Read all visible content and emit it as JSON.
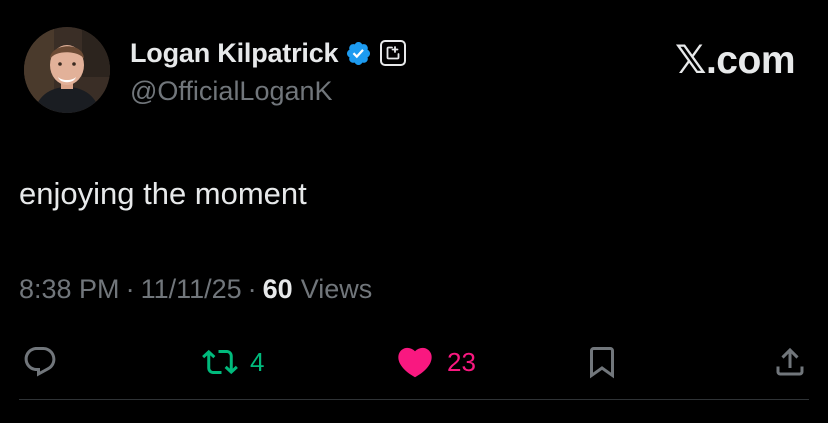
{
  "tweet": {
    "author": {
      "display_name": "Logan Kilpatrick",
      "handle": "@OfficialLoganK",
      "verified": true
    },
    "brand": "𝕏.com",
    "text": "enjoying the moment",
    "time": "8:38 PM",
    "separator": "·",
    "date": "11/11/25",
    "views_count": "60",
    "views_label": "Views"
  },
  "actions": {
    "reply_icon": "reply-icon",
    "retweet_count": "4",
    "like_count": "23",
    "bookmark_icon": "bookmark-icon",
    "share_icon": "share-icon"
  },
  "colors": {
    "background": "#000000",
    "text_primary": "#e7e9ea",
    "text_secondary": "#71767b",
    "verified_blue": "#1d9bf0",
    "retweet_green": "#00ba7c",
    "like_pink": "#f91880",
    "divider": "#2f3336"
  }
}
